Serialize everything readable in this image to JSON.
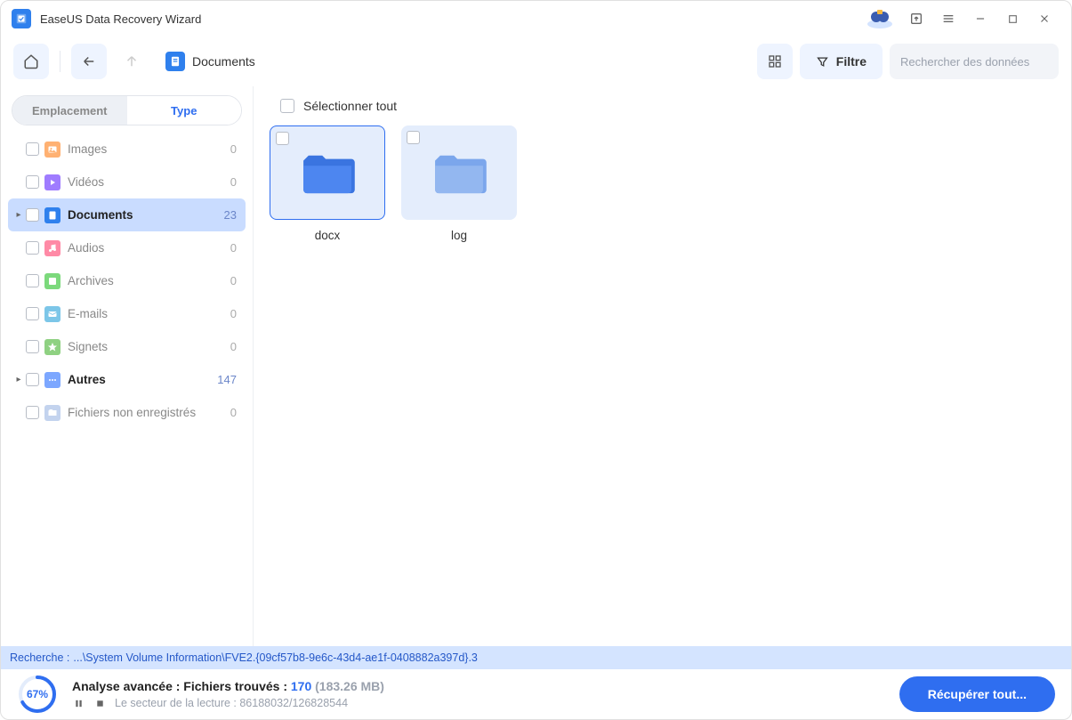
{
  "titlebar": {
    "title": "EaseUS Data Recovery Wizard"
  },
  "toolbar": {
    "breadcrumb": {
      "label": "Documents"
    },
    "filter_label": "Filtre",
    "search_placeholder": "Rechercher des données"
  },
  "sidebar": {
    "tabs": {
      "location": "Emplacement",
      "type": "Type"
    },
    "categories": [
      {
        "label": "Images",
        "count": "0",
        "icon_bg": "#ffb172",
        "selected": false,
        "bold": false,
        "expandable": false
      },
      {
        "label": "Vidéos",
        "count": "0",
        "icon_bg": "#9f7cff",
        "selected": false,
        "bold": false,
        "expandable": false
      },
      {
        "label": "Documents",
        "count": "23",
        "icon_bg": "#2f80ed",
        "selected": true,
        "bold": true,
        "expandable": true
      },
      {
        "label": "Audios",
        "count": "0",
        "icon_bg": "#ff8aa6",
        "selected": false,
        "bold": false,
        "expandable": false
      },
      {
        "label": "Archives",
        "count": "0",
        "icon_bg": "#7cd97c",
        "selected": false,
        "bold": false,
        "expandable": false
      },
      {
        "label": "E-mails",
        "count": "0",
        "icon_bg": "#7cc6e8",
        "selected": false,
        "bold": false,
        "expandable": false
      },
      {
        "label": "Signets",
        "count": "0",
        "icon_bg": "#8fd182",
        "selected": false,
        "bold": false,
        "expandable": false
      },
      {
        "label": "Autres",
        "count": "147",
        "icon_bg": "#7ca7ff",
        "selected": false,
        "bold": true,
        "expandable": true
      },
      {
        "label": "Fichiers non enregistrés",
        "count": "0",
        "icon_bg": "#c3d3ee",
        "selected": false,
        "bold": false,
        "expandable": false
      }
    ]
  },
  "content": {
    "select_all_label": "Sélectionner tout",
    "folders": [
      {
        "name": "docx",
        "selected": true
      },
      {
        "name": "log",
        "selected": false
      }
    ]
  },
  "search_path": {
    "label": "Recherche :",
    "path": "...\\System Volume Information\\FVE2.{09cf57b8-9e6c-43d4-ae1f-0408882a397d}.3"
  },
  "footer": {
    "progress_percent": "67%",
    "progress_value": 67,
    "line1_prefix": "Analyse avancée : Fichiers trouvés : ",
    "found_count": "170",
    "found_size": "(183.26 MB)",
    "sector_label": "Le secteur de la lecture : ",
    "sector_value": "86188032/126828544",
    "recover_label": "Récupérer tout..."
  }
}
